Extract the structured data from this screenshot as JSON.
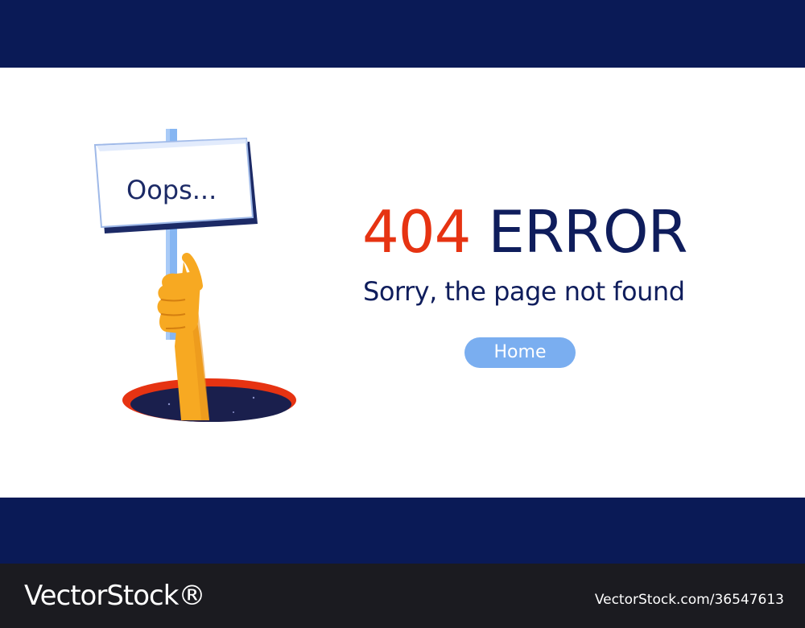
{
  "sign": {
    "text": "Oops..."
  },
  "error": {
    "code": "404",
    "word": "ERROR"
  },
  "message": "Sorry, the page not found",
  "home_button": {
    "label": "Home"
  },
  "watermark": {
    "brand": "VectorStock®",
    "id": "VectorStock.com/36547613"
  },
  "colors": {
    "navy": "#0a1a56",
    "error_red": "#e63312",
    "text_navy": "#0f1d5c",
    "button_blue": "#7aaef0",
    "hand_orange": "#f7a922",
    "hole_rim": "#e63312"
  },
  "icons": [
    "hand-holding-sign-illustration",
    "hole-illustration"
  ]
}
